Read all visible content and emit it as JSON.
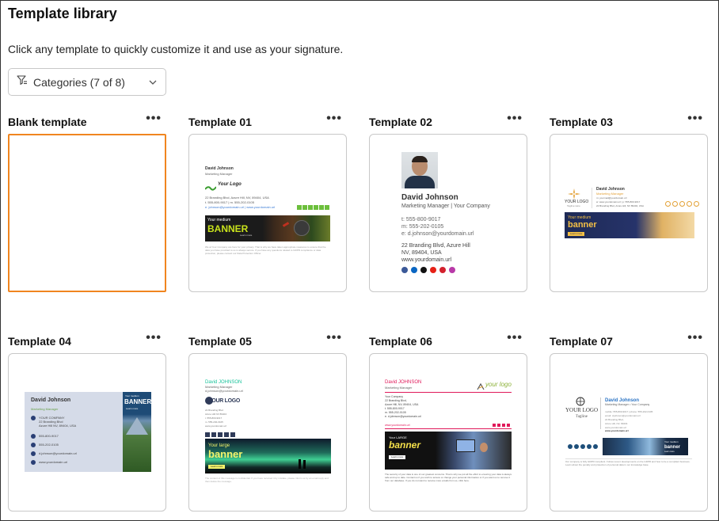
{
  "header": {
    "title": "Template library",
    "subtitle": "Click any template to quickly customize it and use as your signature."
  },
  "filter": {
    "label": "Categories (7 of 8)"
  },
  "menu_glyph": "•••",
  "colors": {
    "selected_border": "#f0851f",
    "card_border": "#c8c8c8"
  },
  "templates": [
    {
      "name": "Blank template"
    },
    {
      "name": "Template 01",
      "person": "David Johnson",
      "role": "Marketing Manager",
      "logo": "Your Logo",
      "address": "22 Branding Blvd, Azure Hill, NV, 89404, USA",
      "phones": "t. 555-800-9017 | m. 555-202-0105",
      "links": "e. johnson@yourdomain.url | www.yourdomain.url",
      "banner_top": "Your medium",
      "banner_main": "BANNER",
      "banner_btn": "Learn more",
      "disclaimer": "We at Your Company are here for your privacy. That is why we have taken appropriate measures to ensure that the data you have provided to us is always secure. If you have any questions related to GDPR compliance or data protection, please contact our Data Protection Officer."
    },
    {
      "name": "Template 02",
      "person": "David Johnson",
      "role": "Marketing Manager | Your Company",
      "t": "t: 555-800-9017",
      "m": "m: 555-202-0105",
      "e": "e: d.johnson@yourdomain.url",
      "addr1": "22 Branding Blvd, Azure Hill",
      "addr2": "NV, 89404, USA",
      "web": "www.yourdomain.url"
    },
    {
      "name": "Template 03",
      "logo_1": "YOUR LOGO",
      "logo_2": "Tagline Here",
      "person": "David Johnson",
      "role": "Marketing Manager",
      "line1": "m: yourmail@yourdomain.url",
      "line2": "w: www.yourdomain.url | p: 555-800-9017",
      "line3": "22 Branding Blvd, Azure Hill, NV 89404, USA",
      "banner_top": "Your medium",
      "banner_main": "banner",
      "banner_btn": "Learn more"
    },
    {
      "name": "Template 04",
      "person": "David Johnson",
      "role": "Marketing Manager",
      "company": "YOUR COMPANY",
      "addr1": "22 Branding Blvd",
      "addr2": "Azure Hill NV, 89404, USA",
      "phone1": "555-800-9017",
      "phone2": "555-202-0105",
      "email": "d.johnson@yourdomain.url",
      "web": "www.yourdomain.url",
      "banner_top": "Your medium",
      "banner_main": "BANNER",
      "banner_btn": "Learn more"
    },
    {
      "name": "Template 05",
      "person": "David JOHNSON",
      "role": "Marketing Manager",
      "email": "d.johnson@yourdomain.url",
      "logo": "YOUR LOGO",
      "i1": "22 Branding Blvd",
      "i2": "Azure Hill NV 89404",
      "i3": "t. 555-800-9017",
      "i4": "m. 555-202-0105",
      "i5": "www.yourdomain.url",
      "banner_top": "Your large",
      "banner_main": "banner",
      "banner_btn": "Learn more",
      "disclaimer": "The content of this message is confidential. If you have received it by mistake, please inform us by an email reply and then delete the message."
    },
    {
      "name": "Template 06",
      "person": "David JOHNSON",
      "role": "Marketing Manager",
      "logo": "your logo",
      "c1": "Your Company",
      "c2": "22 Branding Blvd,",
      "c3": "Azure Hill, NV, 89404, USA",
      "c4": "t. 555-800-9017",
      "c5": "m. 555-202-0105",
      "c6": "e. d.johnson@yourdomain.url",
      "web": "www.yourdomain.url",
      "banner_top": "Your LARGE",
      "banner_main": "banner",
      "banner_btn": "Learn more",
      "disclaimer": "The security of your data is one of our greatest concerns. That is why we put all the effort to ensuring your data is always safe and up to date. Contact us if you wish to access or change your personal information or if you want us to remove it from our database. If you do not want to receive more emails from us, click here."
    },
    {
      "name": "Template 07",
      "logo": "YOUR LOGO",
      "tagline": "Tagline",
      "person": "David Johnson",
      "role": "Marketing Manager • Your Company",
      "l1": "mobile: 555-800-9017 | phone: 555-202-0105",
      "l2": "email: d.johnson@yourdomain.url",
      "l3": "22 Branding Blvd,",
      "l4": "Azure Hill, NV, 89404",
      "l5": "www.yourdomain.url",
      "cta": "www.yourdomain.url",
      "banner_top": "Your medium",
      "banner_main": "banner",
      "banner_btn": "Learn more",
      "disclaimer": "Our company is fully GDPR compliant. Follow recent developments on the GDPR and how to be a compliant business. Learn about the penalty and protection of personal data in our knowledge base."
    }
  ]
}
